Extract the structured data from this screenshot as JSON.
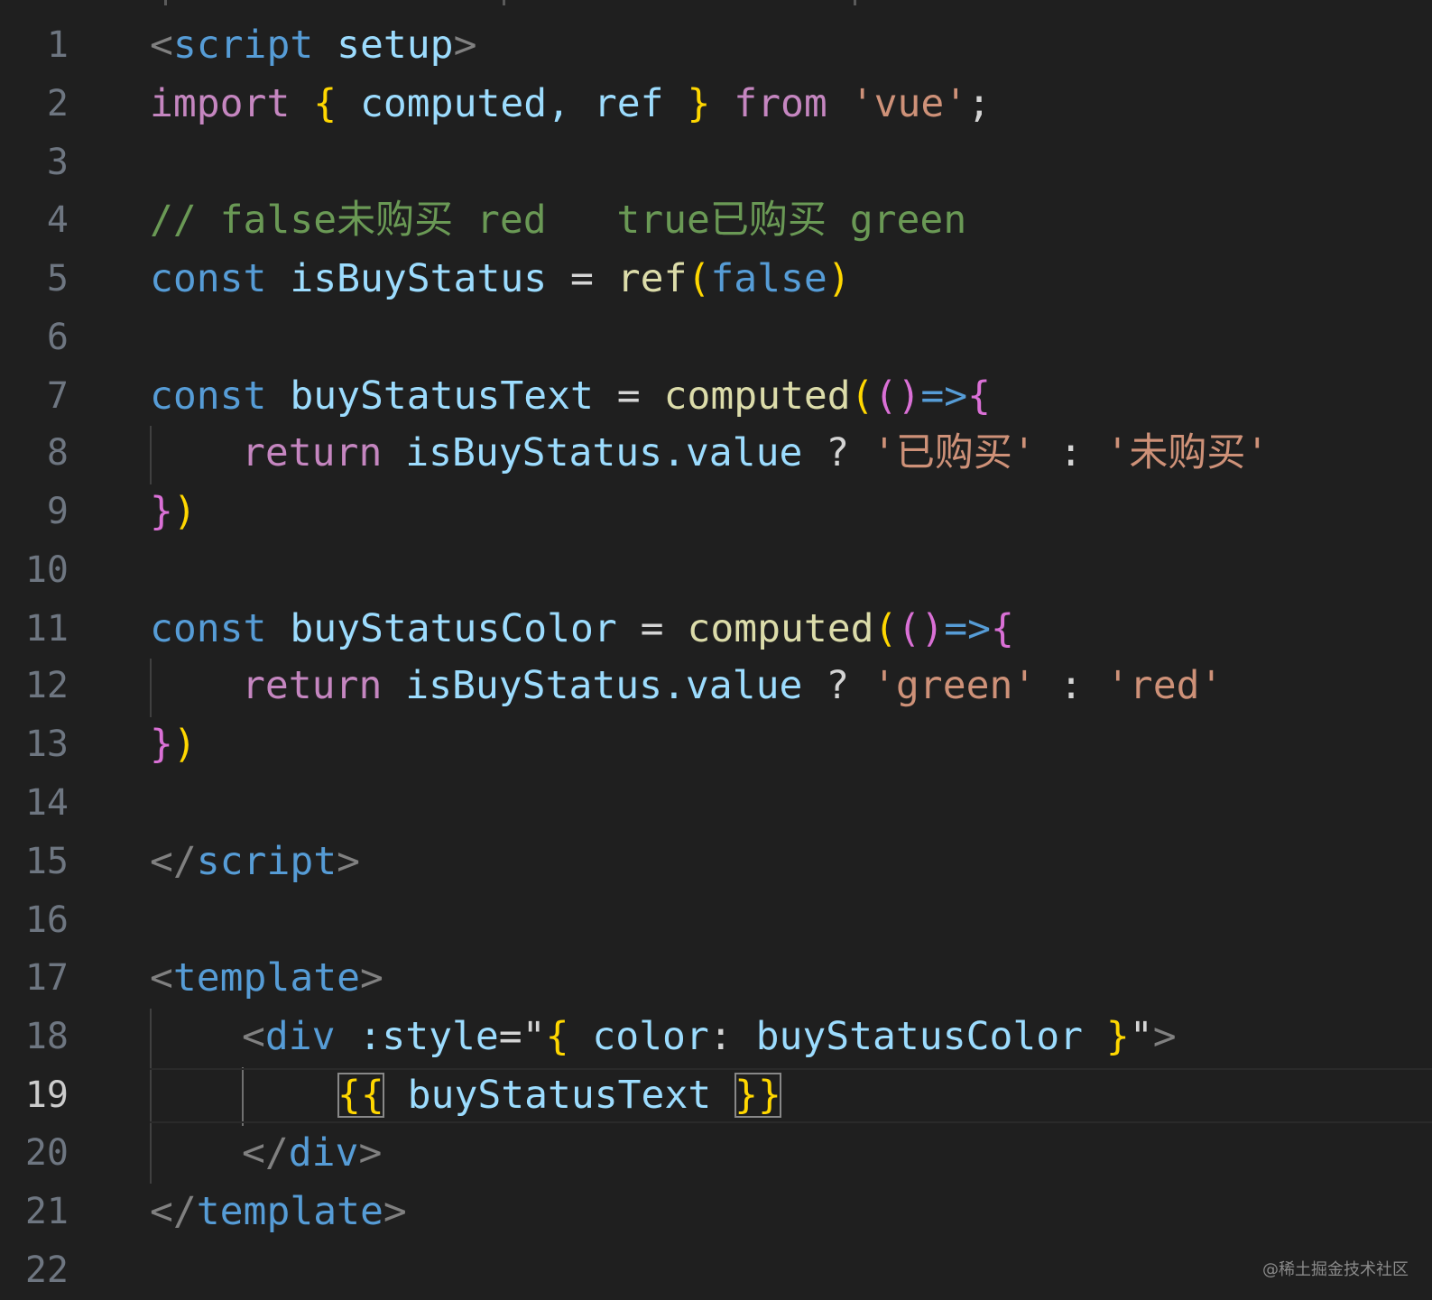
{
  "editor": {
    "line_numbers": [
      "1",
      "2",
      "3",
      "4",
      "5",
      "6",
      "7",
      "8",
      "9",
      "10",
      "11",
      "12",
      "13",
      "14",
      "15",
      "16",
      "17",
      "18",
      "19",
      "20",
      "21",
      "22"
    ],
    "active_line": "19",
    "l1": {
      "open": "<",
      "tag": "script",
      "attr": "setup",
      "close": ">"
    },
    "l2": {
      "import": "import",
      "b_open": "{",
      "names": "computed, ref",
      "b_close": "}",
      "from": "from",
      "module": "'vue'",
      "semi": ";"
    },
    "l4": {
      "comment": "// false未购买 red   true已购买 green"
    },
    "l5": {
      "const": "const",
      "name": "isBuyStatus",
      "eq": "=",
      "fn": "ref",
      "p_open": "(",
      "arg": "false",
      "p_close": ")"
    },
    "l7": {
      "const": "const",
      "name": "buyStatusText",
      "eq": "=",
      "fn": "computed",
      "p_open": "(",
      "params": "()",
      "arrow": "=>",
      "b_open": "{"
    },
    "l8": {
      "return": "return",
      "obj": "isBuyStatus",
      "prop": ".value",
      "q": "?",
      "a": "'已购买'",
      "colon": ":",
      "b": "'未购买'"
    },
    "l9": {
      "b_close": "}",
      "p_close": ")"
    },
    "l11": {
      "const": "const",
      "name": "buyStatusColor",
      "eq": "=",
      "fn": "computed",
      "p_open": "(",
      "params": "()",
      "arrow": "=>",
      "b_open": "{"
    },
    "l12": {
      "return": "return",
      "obj": "isBuyStatus",
      "prop": ".value",
      "q": "?",
      "a": "'green'",
      "colon": ":",
      "b": "'red'"
    },
    "l13": {
      "b_close": "}",
      "p_close": ")"
    },
    "l15": {
      "open": "</",
      "tag": "script",
      "close": ">"
    },
    "l17": {
      "open": "<",
      "tag": "template",
      "close": ">"
    },
    "l18": {
      "open": "<",
      "tag": "div",
      "attr": ":style",
      "eq": "=",
      "q1": "\"",
      "b_open": "{",
      "key": "color",
      "colon": ":",
      "val": "buyStatusColor",
      "b_close": "}",
      "q2": "\"",
      "close": ">"
    },
    "l19": {
      "m_open": "{{",
      "expr": "buyStatusText",
      "m_close": "}}"
    },
    "l20": {
      "open": "</",
      "tag": "div",
      "close": ">"
    },
    "l21": {
      "open": "</",
      "tag": "template",
      "close": ">"
    }
  },
  "watermark": "@稀土掘金技术社区",
  "colors": {
    "background": "#1f1f1f",
    "keyword": "#c586c0",
    "declaration": "#569cd6",
    "variable": "#9cdcfe",
    "function": "#dcdcaa",
    "string": "#ce9178",
    "comment": "#6a9955",
    "bracket_level1": "#ffd700",
    "bracket_level2": "#da70d6",
    "bracket_level3": "#179fff"
  }
}
